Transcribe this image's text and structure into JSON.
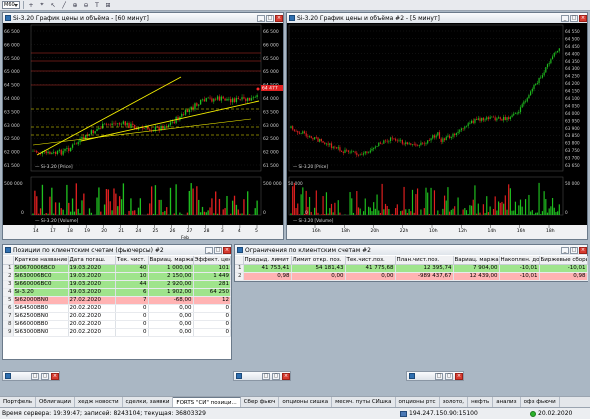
{
  "toolbar": {
    "timeframe": "M60",
    "icons": [
      "plus-icon",
      "crosshair-icon",
      "cursor-icon",
      "line-icon",
      "zoom-in-icon",
      "zoom-out-icon",
      "text-icon",
      "period-icon"
    ]
  },
  "chart1": {
    "title": "Si-3.20 График цены и объёма - [60 минут]",
    "price_legend": "Si-3.20 [Price]",
    "volume_legend": "Si-3.20 [Volume]",
    "price_ticks": [
      "66 500",
      "66 000",
      "65 500",
      "65 000",
      "64 500",
      "64 000",
      "63 500",
      "63 000",
      "62 500",
      "62 000",
      "61 500"
    ],
    "last_price": "64 477",
    "volume_ticks_left": [
      "500 000",
      "0"
    ],
    "volume_ticks_right": [
      "500 000",
      "0"
    ],
    "date_labels": [
      "14",
      "17",
      "18",
      "19",
      "20",
      "21",
      "24",
      "25",
      "26",
      "27",
      "28",
      "3",
      "4",
      "5"
    ],
    "month_label": "Feb",
    "colors": {
      "up": "#1fbf1f",
      "down": "#e02020",
      "trend": "#f5f000",
      "level": "#c0302a",
      "dashed": "#f5f000"
    }
  },
  "chart2": {
    "title": "Si-3.20 График цены и объёма #2 - [5 минут]",
    "price_legend": "Si-3.20 [Price]",
    "volume_legend": "Si-3.20 [Volume]",
    "price_ticks": [
      "64 550",
      "64 500",
      "64 450",
      "64 400",
      "64 350",
      "64 300",
      "64 250",
      "64 200",
      "64 150",
      "64 100",
      "64 050",
      "64 000",
      "63 950",
      "63 900",
      "63 850",
      "63 800",
      "63 750",
      "63 700",
      "63 650"
    ],
    "volume_ticks_left": [
      "50 000",
      "0"
    ],
    "volume_ticks_right": [
      "50 000",
      "0"
    ],
    "time_labels": [
      "16h",
      "18h",
      "20h",
      "22h",
      "10h",
      "12h",
      "14h",
      "16h",
      "18h"
    ]
  },
  "positions": {
    "title": "Позиции по клиентским счетам (фьючерсы) #2",
    "columns": [
      "",
      "Краткое название",
      "Дата погаш.",
      "Тек. чист.",
      "Вариац. маржа",
      "Эффект. цен."
    ],
    "rows": [
      {
        "idx": "1",
        "name": "Si0670006BC0",
        "date": "19.03.2020",
        "net": "40",
        "margin": "1 000,00",
        "price": "101",
        "style": "green"
      },
      {
        "idx": "2",
        "name": "Si630006BC0",
        "date": "19.03.2020",
        "net": "10",
        "margin": "2 150,00",
        "price": "1 449",
        "style": "green"
      },
      {
        "idx": "3",
        "name": "Si660006BC0",
        "date": "19.03.2020",
        "net": "44",
        "margin": "2 920,00",
        "price": "281",
        "style": "green"
      },
      {
        "idx": "4",
        "name": "Si-3.20",
        "date": "19.03.2020",
        "net": "6",
        "margin": "1 902,00",
        "price": "64 250",
        "style": "green"
      },
      {
        "idx": "5",
        "name": "Si62000BN0",
        "date": "27.02.2020",
        "net": "7",
        "margin": "-68,00",
        "price": "12",
        "style": "red"
      },
      {
        "idx": "6",
        "name": "Si64500BB0",
        "date": "20.02.2020",
        "net": "0",
        "margin": "0,00",
        "price": "0",
        "style": "white"
      },
      {
        "idx": "7",
        "name": "Si62500BN0",
        "date": "20.02.2020",
        "net": "0",
        "margin": "0,00",
        "price": "0",
        "style": "white"
      },
      {
        "idx": "8",
        "name": "Si66000BB0",
        "date": "20.02.2020",
        "net": "0",
        "margin": "0,00",
        "price": "0",
        "style": "white"
      },
      {
        "idx": "9",
        "name": "Si63000BN0",
        "date": "20.02.2020",
        "net": "0",
        "margin": "0,00",
        "price": "0",
        "style": "white"
      }
    ]
  },
  "limits": {
    "title": "Ограничения по клиентским счетам #2",
    "columns": [
      "",
      "Предыд. лимит",
      "Лимит откр. поз.",
      "Тек.чист.поз.",
      "План.чист.поз.",
      "Вариац. маржа",
      "Накоплен. доход",
      "Биржевые сборы"
    ],
    "rows": [
      {
        "idx": "1",
        "cells": [
          "41 753,41",
          "54 181,43",
          "41 775,68",
          "12 395,74",
          "7 904,00",
          "-10,01",
          "-10,01"
        ],
        "style": "green"
      },
      {
        "idx": "2",
        "cells": [
          "0,98",
          "0,00",
          "0,00",
          "-989 437,67",
          "12 439,00",
          "-10,01",
          "0,98"
        ],
        "style": "red"
      }
    ]
  },
  "tabs": [
    "Портфель",
    "Облигации",
    "хедж новости",
    "сделки, заявки",
    "FORTS \"СИ\" позици...",
    "Сбер фьюч",
    "опционы сишка",
    "месяч. путы СИшка",
    "опционы ртс",
    "золото,",
    "нефть",
    "анализ",
    "офз фьючи"
  ],
  "active_tab": 4,
  "status": {
    "left": "Время сервера: 19:39:47; записей: 8243104; текущая: 36803329",
    "server": "194.247.150.90:15100",
    "date": "20.02.2020"
  }
}
